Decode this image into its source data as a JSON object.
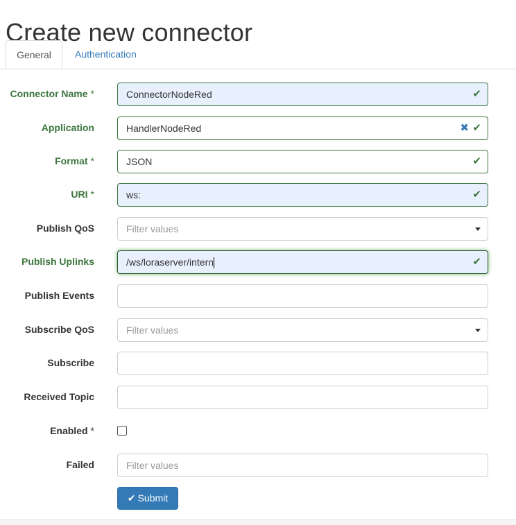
{
  "page": {
    "title": "Create new connector"
  },
  "tabs": [
    {
      "label": "General",
      "active": true
    },
    {
      "label": "Authentication",
      "active": false
    }
  ],
  "fields": {
    "connector_name": {
      "label": "Connector Name",
      "required": "*",
      "value": "ConnectorNodeRed"
    },
    "application": {
      "label": "Application",
      "value": "HandlerNodeRed"
    },
    "format": {
      "label": "Format",
      "required": "*",
      "value": "JSON"
    },
    "uri": {
      "label": "URI",
      "required": "*",
      "value": "ws:"
    },
    "publish_qos": {
      "label": "Publish QoS",
      "placeholder": "Filter values"
    },
    "publish_uplinks": {
      "label": "Publish Uplinks",
      "value": "/ws/loraserver/intern"
    },
    "publish_events": {
      "label": "Publish Events",
      "value": ""
    },
    "subscribe_qos": {
      "label": "Subscribe QoS",
      "placeholder": "Filter values"
    },
    "subscribe": {
      "label": "Subscribe",
      "value": ""
    },
    "received_topic": {
      "label": "Received Topic",
      "value": ""
    },
    "enabled": {
      "label": "Enabled",
      "required": "*",
      "checked": false
    },
    "failed": {
      "label": "Failed",
      "placeholder": "Filter values"
    }
  },
  "icons": {
    "valid": "check-icon",
    "clear": "clear-icon",
    "dropdown": "caret-down-icon",
    "submit": "check-icon"
  },
  "actions": {
    "submit_label": "Submit",
    "submit_icon": "✔"
  },
  "colors": {
    "valid": "#3c763d",
    "primary": "#337ab7",
    "autofill": "#e8f0fe"
  }
}
